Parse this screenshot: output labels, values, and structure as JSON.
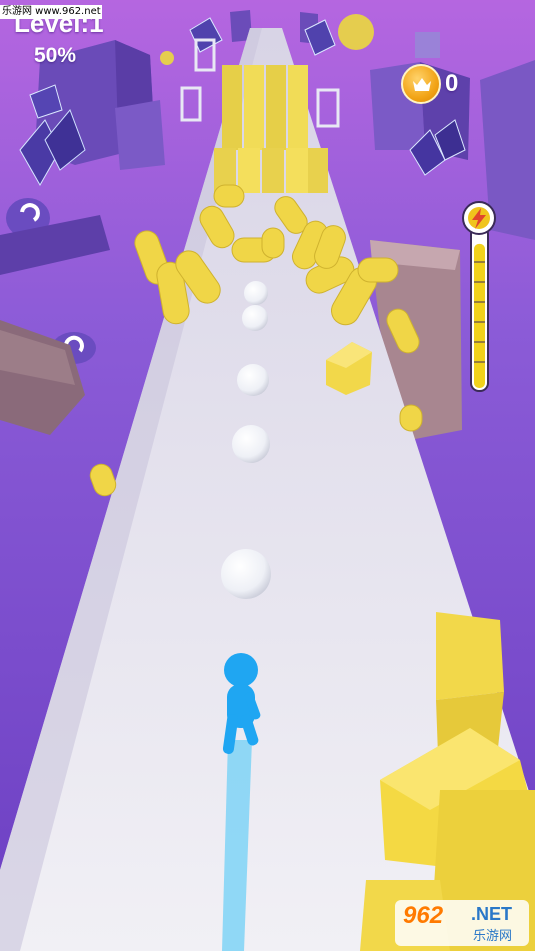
{
  "watermark": {
    "top": "乐游网 www.962.net",
    "brand": "962",
    "domain": ".NET",
    "site_name": "乐游网"
  },
  "hud": {
    "level": "Level:1",
    "progress": "50%",
    "crowns": "0",
    "power_meter_level": 0.93
  },
  "icons": {
    "crown": "crown-icon",
    "power": "lightning-icon"
  },
  "colors": {
    "sky": "#8a5bd6",
    "track": "#e9e7ef",
    "player": "#1fa6f2",
    "obstacle": "#f2d84a",
    "ball": "#ffffff"
  }
}
